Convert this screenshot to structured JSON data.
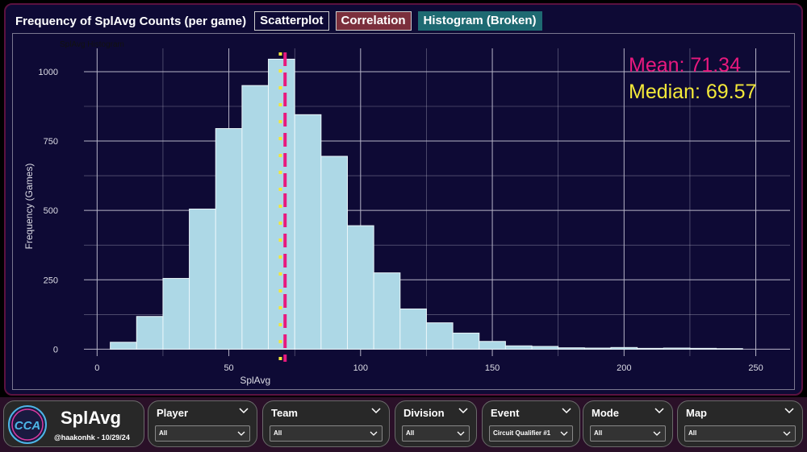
{
  "header": {
    "title": "Frequency of SplAvg Counts (per game)",
    "tabs": [
      "Scatterplot",
      "Correlation",
      "Histogram (Broken)"
    ]
  },
  "chart_data": {
    "type": "bar",
    "subtitle": "SplAvg Histogram",
    "xlabel": "SplAvg",
    "ylabel": "Frequency (Games)",
    "xlim": [
      -5,
      263
    ],
    "ylim": [
      -25,
      1055
    ],
    "x_ticks": [
      0,
      50,
      100,
      150,
      200,
      250
    ],
    "y_ticks": [
      0,
      250,
      500,
      750,
      1000
    ],
    "bin_width": 10,
    "bin_starts": [
      5,
      15,
      25,
      35,
      45,
      55,
      65,
      75,
      85,
      95,
      105,
      115,
      125,
      135,
      145,
      155,
      165,
      175,
      185,
      195,
      205,
      215,
      225,
      235
    ],
    "values": [
      25,
      118,
      255,
      505,
      795,
      950,
      1045,
      845,
      695,
      445,
      275,
      145,
      95,
      58,
      28,
      12,
      10,
      5,
      4,
      6,
      3,
      4,
      3,
      2
    ],
    "mean": 71.34,
    "median": 69.57,
    "mean_label": "Mean:  71.34",
    "median_label": "Median:  69.57",
    "colors": {
      "bar": "#add8e6",
      "mean": "#e8197e",
      "median": "#f3e839",
      "background": "#0e0a35"
    },
    "grid": true
  },
  "footer": {
    "logo_title": "SplAvg",
    "logo_sub": "@haakonhk - 10/29/24",
    "logo_badge": "CCA",
    "filters": [
      {
        "label": "Player",
        "value": "All"
      },
      {
        "label": "Team",
        "value": "All"
      },
      {
        "label": "Division",
        "value": "All"
      },
      {
        "label": "Event",
        "value": "Circuit Qualifier #1"
      },
      {
        "label": "Mode",
        "value": "All"
      },
      {
        "label": "Map",
        "value": "All"
      }
    ]
  }
}
